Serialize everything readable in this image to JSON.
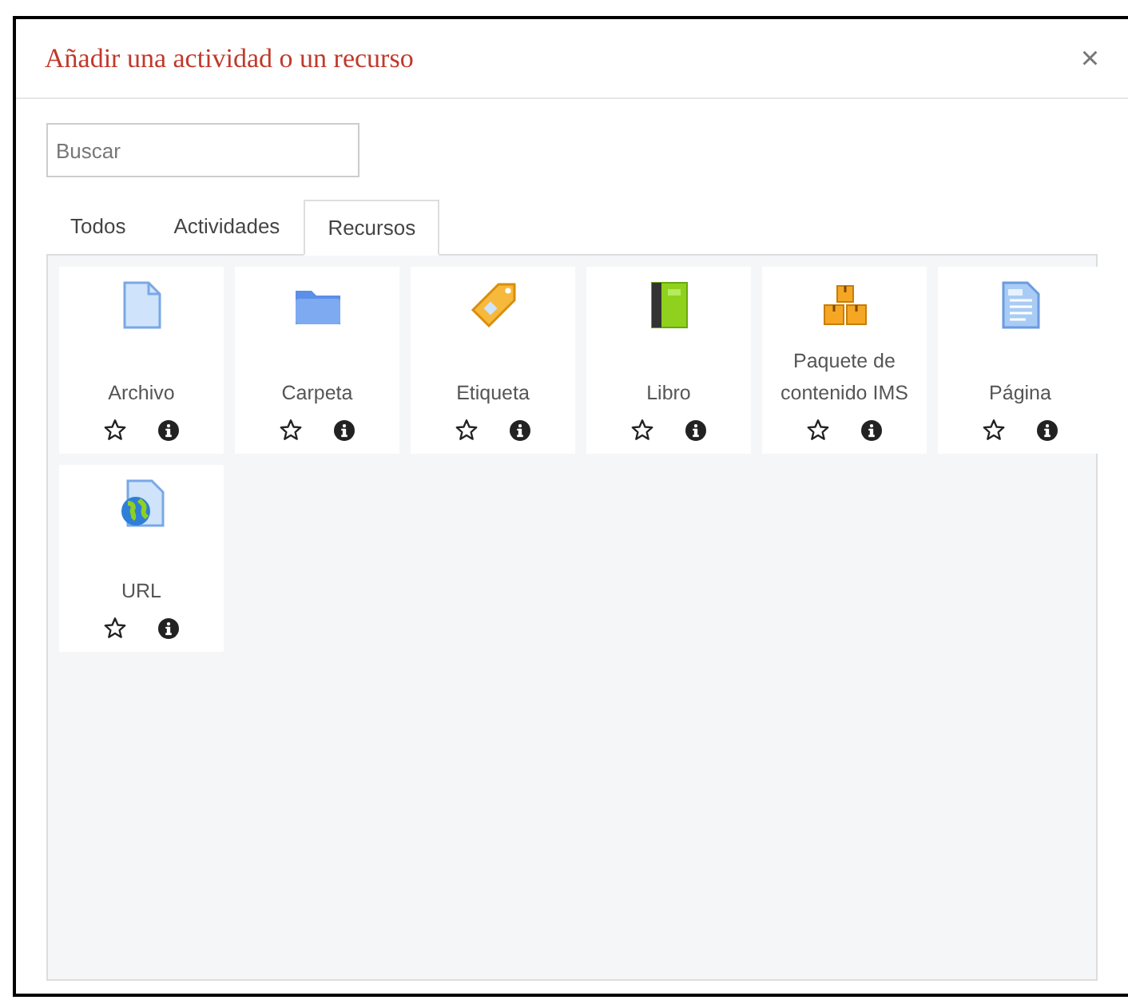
{
  "dialog": {
    "title": "Añadir una actividad o un recurso",
    "close": "×"
  },
  "search": {
    "placeholder": "Buscar"
  },
  "tabs": [
    {
      "label": "Todos",
      "selected": false
    },
    {
      "label": "Actividades",
      "selected": false
    },
    {
      "label": "Recursos",
      "selected": true
    }
  ],
  "items": [
    {
      "name": "Archivo",
      "kind": "file"
    },
    {
      "name": "Carpeta",
      "kind": "folder"
    },
    {
      "name": "Etiqueta",
      "kind": "label"
    },
    {
      "name": "Libro",
      "kind": "book"
    },
    {
      "name": "Paquete de contenido IMS",
      "kind": "package"
    },
    {
      "name": "Página",
      "kind": "page"
    },
    {
      "name": "URL",
      "kind": "url"
    }
  ]
}
